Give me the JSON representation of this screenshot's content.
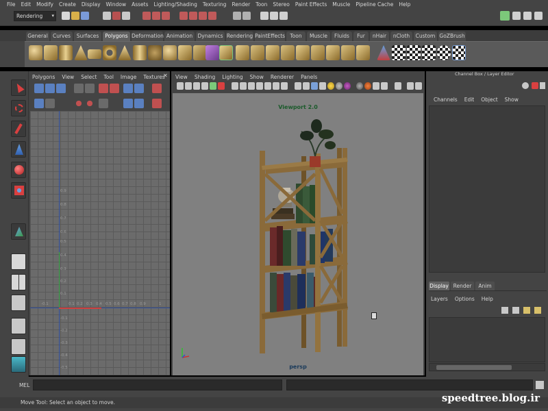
{
  "menubar": [
    "File",
    "Edit",
    "Modify",
    "Create",
    "Display",
    "Window",
    "Assets",
    "Lighting/Shading",
    "Texturing",
    "Render",
    "Toon",
    "Stereo",
    "Paint Effects",
    "Muscle",
    "Pipeline Cache",
    "Help"
  ],
  "status_line": {
    "mode": "Rendering"
  },
  "shelf_tabs": [
    "General",
    "Curves",
    "Surfaces",
    "Polygons",
    "Deformation",
    "Animation",
    "Dynamics",
    "Rendering",
    "PaintEffects",
    "Toon",
    "Muscle",
    "Fluids",
    "Fur",
    "nHair",
    "nCloth",
    "Custom",
    "GoZBrush"
  ],
  "shelf_active": "Polygons",
  "uv_editor": {
    "menu": [
      "Polygons",
      "View",
      "Select",
      "Tool",
      "Image",
      "Textures"
    ],
    "v_labels": [
      "0.9",
      "0.8",
      "0.7",
      "0.6",
      "0.5",
      "0.4",
      "0.3",
      "0.2",
      "0.1"
    ],
    "u_labels": [
      "-0.1",
      "0.1",
      "0.2",
      "0.3",
      "0.4",
      "0.5",
      "0.6",
      "0.7",
      "0.8",
      "0.9",
      "1"
    ],
    "neg_labels": [
      "-0.1",
      "-0.2",
      "-0.3",
      "-0.4",
      "-0.5"
    ]
  },
  "viewport": {
    "menu": [
      "View",
      "Shading",
      "Lighting",
      "Show",
      "Renderer",
      "Panels"
    ],
    "title": "Viewport 2.0",
    "camera": "persp"
  },
  "channel_box": {
    "title": "Channel Box / Layer Editor",
    "menu": [
      "Channels",
      "Edit",
      "Object",
      "Show"
    ]
  },
  "layer_editor": {
    "tabs": [
      "Display",
      "Render",
      "Anim"
    ],
    "active_tab": "Display",
    "menu": [
      "Layers",
      "Options",
      "Help"
    ]
  },
  "command_line": {
    "label": "MEL"
  },
  "help_line": "Move Tool: Select an object to move.",
  "watermark": "speedtree.blog.ir",
  "colors": {
    "ui_bg": "#444444",
    "viewport_bg": "#808080",
    "uv_grid": "#6b6b6b",
    "wood": "#8a6a3a"
  }
}
